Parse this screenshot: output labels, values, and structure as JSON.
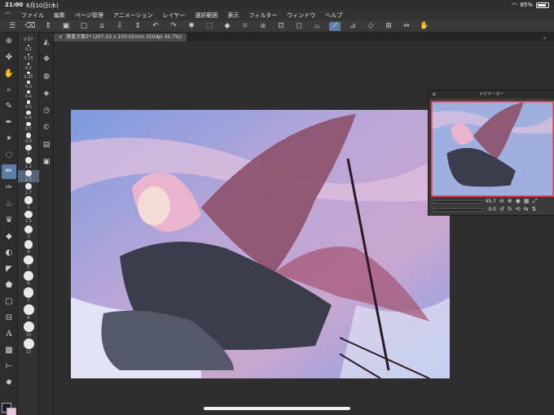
{
  "status_bar": {
    "time": "21:00",
    "date": "6月10日(木)",
    "battery": "85%",
    "battery_level": 0.85
  },
  "menu": {
    "items": [
      "ファイル",
      "編集",
      "ページ管理",
      "アニメーション",
      "レイヤー",
      "選択範囲",
      "表示",
      "フィルター",
      "ウィンドウ",
      "ヘルプ"
    ]
  },
  "document_tab": {
    "label": "落書き類3* (297.03 x 210.02mm 350dpi 45.7%)"
  },
  "navigator": {
    "title": "ナビゲーター",
    "zoom": "45.7",
    "rotation": "0.0"
  },
  "brush_sizes": [
    "0.07",
    "0.1",
    "0.15",
    "0.2",
    "0.25",
    "0.3",
    "0.4",
    "0.5",
    "0.6",
    "0.7",
    "0.8",
    "1",
    "1.2",
    "1.5",
    "1.7",
    "2",
    "2.5",
    "3",
    "4",
    "5",
    "6",
    "7",
    "8",
    "10",
    "12"
  ],
  "selected_brush_size": "1.5",
  "colors": {
    "main": "#1b1a2e",
    "sub": "#f0c4dc",
    "accent": "#5a7fa8"
  }
}
